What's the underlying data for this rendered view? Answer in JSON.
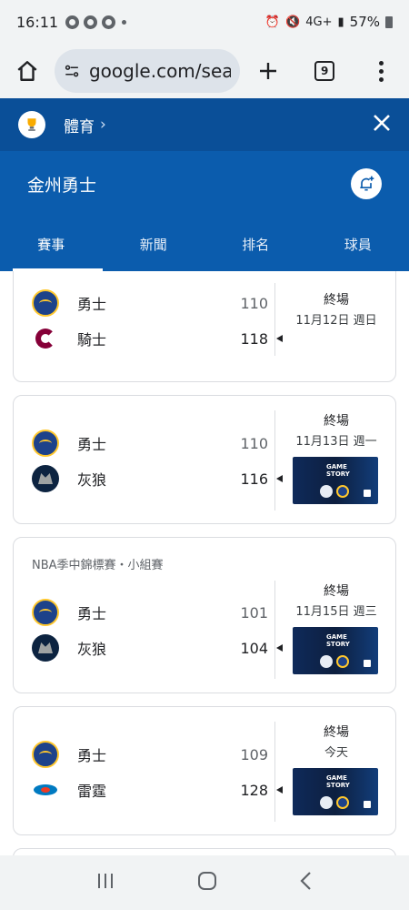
{
  "status_bar": {
    "time": "16:11",
    "network": "4G+",
    "battery": "57%"
  },
  "browser": {
    "url": "google.com/search",
    "tab_count": "9"
  },
  "sports": {
    "breadcrumb": "體育",
    "team_title": "金州勇士",
    "tabs": [
      "賽事",
      "新聞",
      "排名",
      "球員"
    ],
    "active_tab": 0
  },
  "games": [
    {
      "league": "",
      "home": {
        "name": "勇士",
        "score": "110",
        "logo": "warriors-logo",
        "winner": false
      },
      "away": {
        "name": "騎士",
        "score": "118",
        "logo": "cavaliers-logo",
        "winner": true
      },
      "status": "終場",
      "date": "11月12日 週日",
      "has_video": false
    },
    {
      "league": "",
      "home": {
        "name": "勇士",
        "score": "110",
        "logo": "warriors-logo",
        "winner": false
      },
      "away": {
        "name": "灰狼",
        "score": "116",
        "logo": "timberwolves-logo",
        "winner": true
      },
      "status": "終場",
      "date": "11月13日 週一",
      "has_video": true,
      "video_label": "GAME STORY"
    },
    {
      "league": "NBA季中錦標賽・小組賽",
      "home": {
        "name": "勇士",
        "score": "101",
        "logo": "warriors-logo",
        "winner": false
      },
      "away": {
        "name": "灰狼",
        "score": "104",
        "logo": "timberwolves-logo",
        "winner": true
      },
      "status": "終場",
      "date": "11月15日 週三",
      "has_video": true,
      "video_label": "GAME STORY"
    },
    {
      "league": "",
      "home": {
        "name": "勇士",
        "score": "109",
        "logo": "warriors-logo",
        "winner": false
      },
      "away": {
        "name": "雷霆",
        "score": "128",
        "logo": "thunder-logo",
        "winner": true
      },
      "status": "終場",
      "date": "今天",
      "has_video": true,
      "video_label": "GAME STORY"
    }
  ],
  "colors": {
    "header_blue": "#0b5cad",
    "header_dark": "#0a4f98",
    "warriors_blue": "#1d428a",
    "warriors_gold": "#ffc72c"
  }
}
